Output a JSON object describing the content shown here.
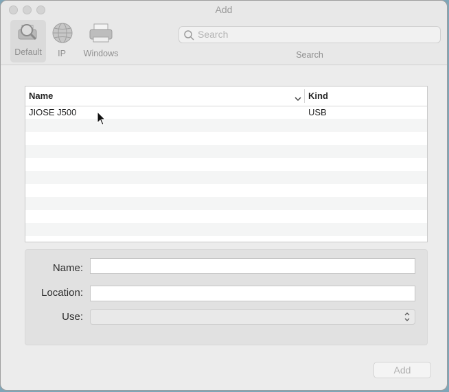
{
  "window": {
    "title": "Add"
  },
  "toolbar": {
    "items": [
      {
        "label": "Default",
        "icon": "default-printer-magnifier-icon"
      },
      {
        "label": "IP",
        "icon": "globe-icon"
      },
      {
        "label": "Windows",
        "icon": "windows-printer-icon"
      }
    ],
    "search": {
      "placeholder": "Search",
      "label": "Search"
    }
  },
  "printer_list": {
    "columns": [
      "Name",
      "Kind"
    ],
    "rows": [
      {
        "name": "JIOSE J500",
        "kind": "USB"
      }
    ]
  },
  "form": {
    "name_label": "Name:",
    "location_label": "Location:",
    "use_label": "Use:",
    "name_value": "",
    "location_value": "",
    "use_value": ""
  },
  "buttons": {
    "add_label": "Add"
  }
}
